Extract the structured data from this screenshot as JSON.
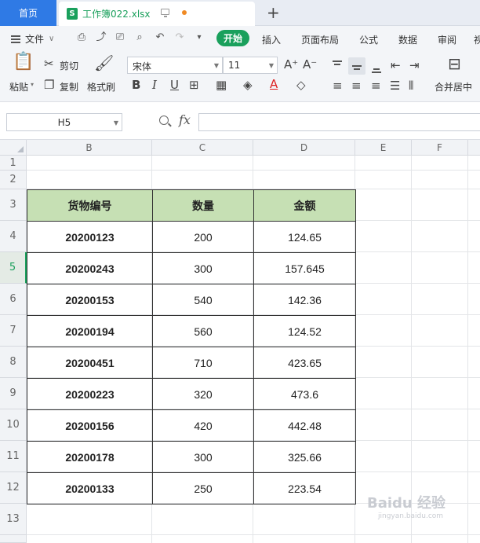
{
  "tabs": {
    "home": "首页",
    "file_badge": "S",
    "file_name": "工作簿022.xlsx",
    "new_tab": "+"
  },
  "menu": {
    "file": "文件",
    "items": [
      "开始",
      "插入",
      "页面布局",
      "公式",
      "数据",
      "审阅"
    ],
    "overflow": "视"
  },
  "ribbon": {
    "paste": "粘贴",
    "cut": "剪切",
    "copy": "复制",
    "format_painter": "格式刷",
    "font_name": "宋体",
    "font_size": "11",
    "merge_center": "合并居中"
  },
  "formula_bar": {
    "name_box": "H5",
    "fx": "fx",
    "formula": ""
  },
  "grid": {
    "columns": [
      "B",
      "C",
      "D",
      "E",
      "F"
    ],
    "rows": [
      "1",
      "2",
      "3",
      "4",
      "5",
      "6",
      "7",
      "8",
      "9",
      "10",
      "11",
      "12",
      "13"
    ],
    "active_row": "5"
  },
  "table": {
    "headers": [
      "货物编号",
      "数量",
      "金额"
    ],
    "rows": [
      [
        "20200123",
        "200",
        "124.65"
      ],
      [
        "20200243",
        "300",
        "157.645"
      ],
      [
        "20200153",
        "540",
        "142.36"
      ],
      [
        "20200194",
        "560",
        "124.52"
      ],
      [
        "20200451",
        "710",
        "423.65"
      ],
      [
        "20200223",
        "320",
        "473.6"
      ],
      [
        "20200156",
        "420",
        "442.48"
      ],
      [
        "20200178",
        "300",
        "325.66"
      ],
      [
        "20200133",
        "250",
        "223.54"
      ]
    ]
  },
  "watermark": {
    "brand": "Baidu 经验",
    "url": "jingyan.baidu.com"
  },
  "colors": {
    "accent": "#1aa05c",
    "home_tab": "#2f7ae5",
    "header_fill": "#c6e0b4"
  }
}
